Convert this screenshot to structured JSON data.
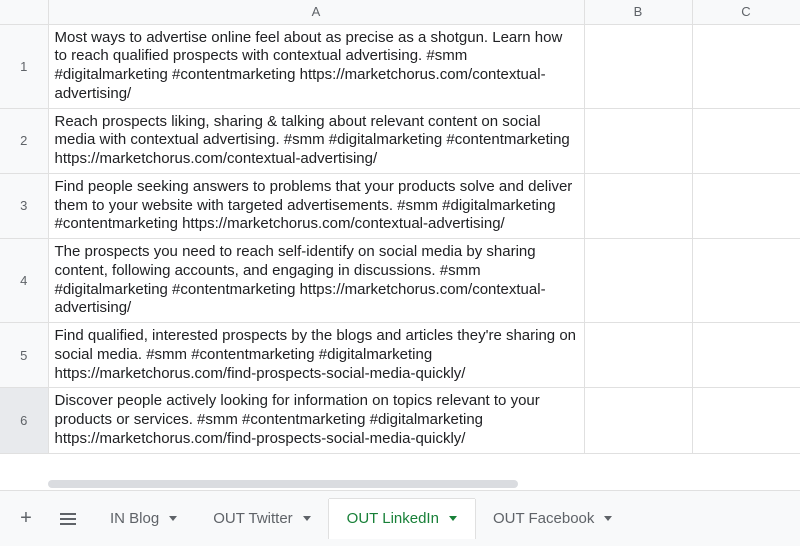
{
  "columns": {
    "A": "A",
    "B": "B",
    "C": "C"
  },
  "rows": [
    {
      "n": "1",
      "A": "Most ways to advertise online feel about as precise as a shotgun. Learn how to reach qualified prospects with contextual advertising. #smm #digitalmarketing #contentmarketing https://marketchorus.com/contextual-advertising/"
    },
    {
      "n": "2",
      "A": "Reach prospects liking, sharing & talking about relevant content on social media with contextual advertising. #smm #digitalmarketing #contentmarketing https://marketchorus.com/contextual-advertising/"
    },
    {
      "n": "3",
      "A": "Find people seeking answers to problems that your products solve and deliver them to your website with targeted advertisements. #smm #digitalmarketing #contentmarketing https://marketchorus.com/contextual-advertising/"
    },
    {
      "n": "4",
      "A": "The prospects you need to reach self-identify on social media by sharing content, following accounts, and engaging in discussions. #smm #digitalmarketing #contentmarketing https://marketchorus.com/contextual-advertising/"
    },
    {
      "n": "5",
      "A": "Find qualified, interested prospects by the blogs and articles they're sharing on social media. #smm #contentmarketing #digitalmarketing https://marketchorus.com/find-prospects-social-media-quickly/"
    },
    {
      "n": "6",
      "A": "Discover people actively looking for information on topics relevant to your products or services. #smm #contentmarketing #digitalmarketing https://marketchorus.com/find-prospects-social-media-quickly/"
    }
  ],
  "tabs": {
    "add": "+",
    "in_blog": "IN Blog",
    "out_twitter": "OUT Twitter",
    "out_linkedin": "OUT LinkedIn",
    "out_facebook": "OUT Facebook"
  }
}
